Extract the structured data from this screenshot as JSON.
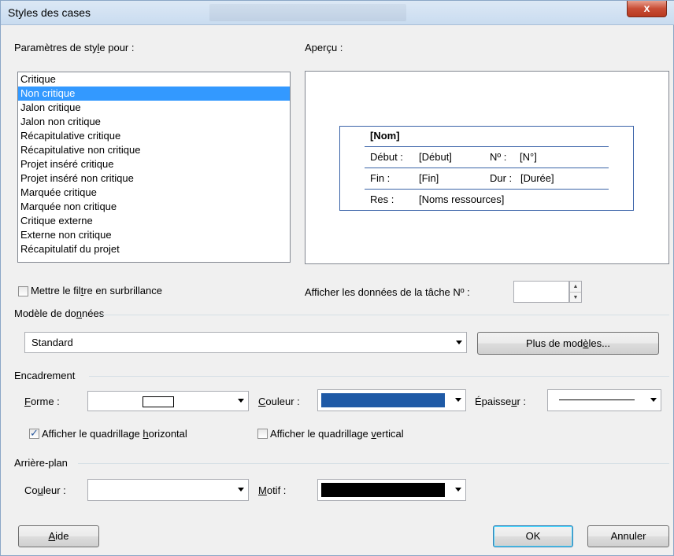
{
  "window": {
    "title": "Styles des cases",
    "close_label": "x"
  },
  "style_params": {
    "label_pre": "Paramètres de sty",
    "label_key": "l",
    "label_post": "e pour :",
    "items": [
      "Critique",
      "Non critique",
      "Jalon critique",
      "Jalon non critique",
      "Récapitulative critique",
      "Récapitulative non critique",
      "Projet inséré critique",
      "Projet inséré non critique",
      "Marquée critique",
      "Marquée non critique",
      "Critique externe",
      "Externe non critique",
      "Récapitulatif du projet"
    ],
    "selected_index": 1
  },
  "preview": {
    "label": "Aperçu :",
    "card": {
      "name": "[Nom]",
      "debut_label": "Début :",
      "debut_value": "[Début]",
      "no_label": "Nº :",
      "no_value": "[N°]",
      "fin_label": "Fin :",
      "fin_value": "[Fin]",
      "dur_label": "Dur :",
      "dur_value": "[Durée]",
      "res_label": "Res :",
      "res_value": "[Noms ressources]"
    }
  },
  "highlight_filter": {
    "label_pre": "Mettre le fil",
    "label_key": "t",
    "label_post": "re en surbrillance",
    "checked": false
  },
  "task_data": {
    "label": "Afficher les données de la tâche Nº :",
    "value": ""
  },
  "data_template": {
    "label_pre": "Modèle de do",
    "label_key": "n",
    "label_post": "nées",
    "selected": "Standard",
    "more_button_pre": "Plus de mod",
    "more_button_key": "è",
    "more_button_post": "les..."
  },
  "border": {
    "section_label": "Encadrement",
    "shape_label_key": "F",
    "shape_label_post": "orme :",
    "color_label_key": "C",
    "color_label_post": "ouleur :",
    "color_value": "#1f5aa6",
    "thickness_label_pre": "Épaisse",
    "thickness_label_key": "u",
    "thickness_label_post": "r :",
    "horizontal_grid": {
      "label_pre": "Afficher le quadrillage ",
      "label_key": "h",
      "label_post": "orizontal",
      "checked": true
    },
    "vertical_grid": {
      "label_pre": "Afficher le quadrillage ",
      "label_key": "v",
      "label_post": "ertical",
      "checked": false
    }
  },
  "background": {
    "section_label": "Arrière-plan",
    "color_label_pre": "Co",
    "color_label_key": "u",
    "color_label_post": "leur :",
    "color_value": "#ffffff",
    "pattern_label_key": "M",
    "pattern_label_post": "otif :",
    "pattern_value": "#000000"
  },
  "buttons": {
    "help_key": "A",
    "help_post": "ide",
    "ok": "OK",
    "cancel": "Annuler"
  }
}
